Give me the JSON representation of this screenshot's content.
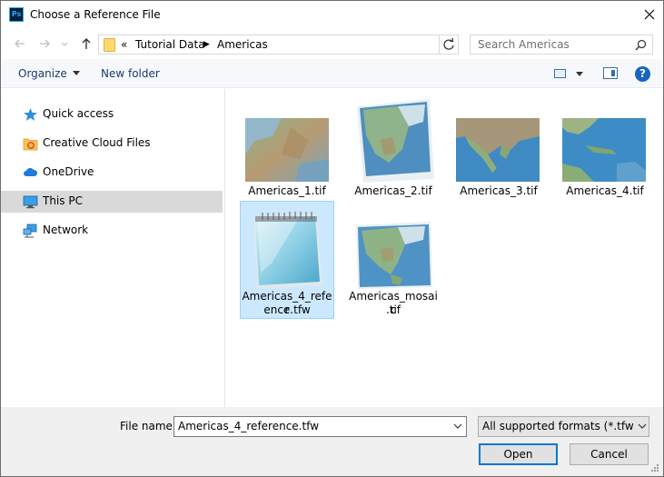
{
  "window": {
    "title": "Choose a Reference File",
    "app_icon_label": "Ps"
  },
  "address": {
    "overflow": "«",
    "crumbs": [
      "Tutorial Data",
      "Americas"
    ]
  },
  "search": {
    "placeholder": "Search Americas"
  },
  "toolbar": {
    "organize": "Organize",
    "new_folder": "New folder",
    "help": "?"
  },
  "sidebar": {
    "items": [
      {
        "label": "Quick access",
        "icon": "star-icon"
      },
      {
        "label": "Creative Cloud Files",
        "icon": "creative-cloud-folder-icon"
      },
      {
        "label": "OneDrive",
        "icon": "cloud-icon"
      },
      {
        "label": "This PC",
        "icon": "computer-icon",
        "selected": true
      },
      {
        "label": "Network",
        "icon": "network-icon"
      }
    ]
  },
  "files": [
    {
      "name": "Americas_1.tif",
      "kind": "map"
    },
    {
      "name": "Americas_2.tif",
      "kind": "map"
    },
    {
      "name": "Americas_3.tif",
      "kind": "map"
    },
    {
      "name": "Americas_4.tif",
      "kind": "map"
    },
    {
      "name_line1": "Americas_4_refer",
      "name_line2": "ence.tfw",
      "kind": "notepad",
      "selected": true
    },
    {
      "name_line1": "Americas_mosaic",
      "name_line2": ".tif",
      "kind": "map"
    }
  ],
  "bottom": {
    "file_name_label": "File name:",
    "file_name_value": "Americas_4_reference.tfw",
    "format_value": "All supported formats (*.tfw *.ti",
    "open_label": "Open",
    "cancel_label": "Cancel"
  },
  "colors": {
    "selection": "#cce8ff",
    "sidebar_selected": "#d9d9d9",
    "accent": "#0078d7",
    "link": "#1a3a6e"
  }
}
